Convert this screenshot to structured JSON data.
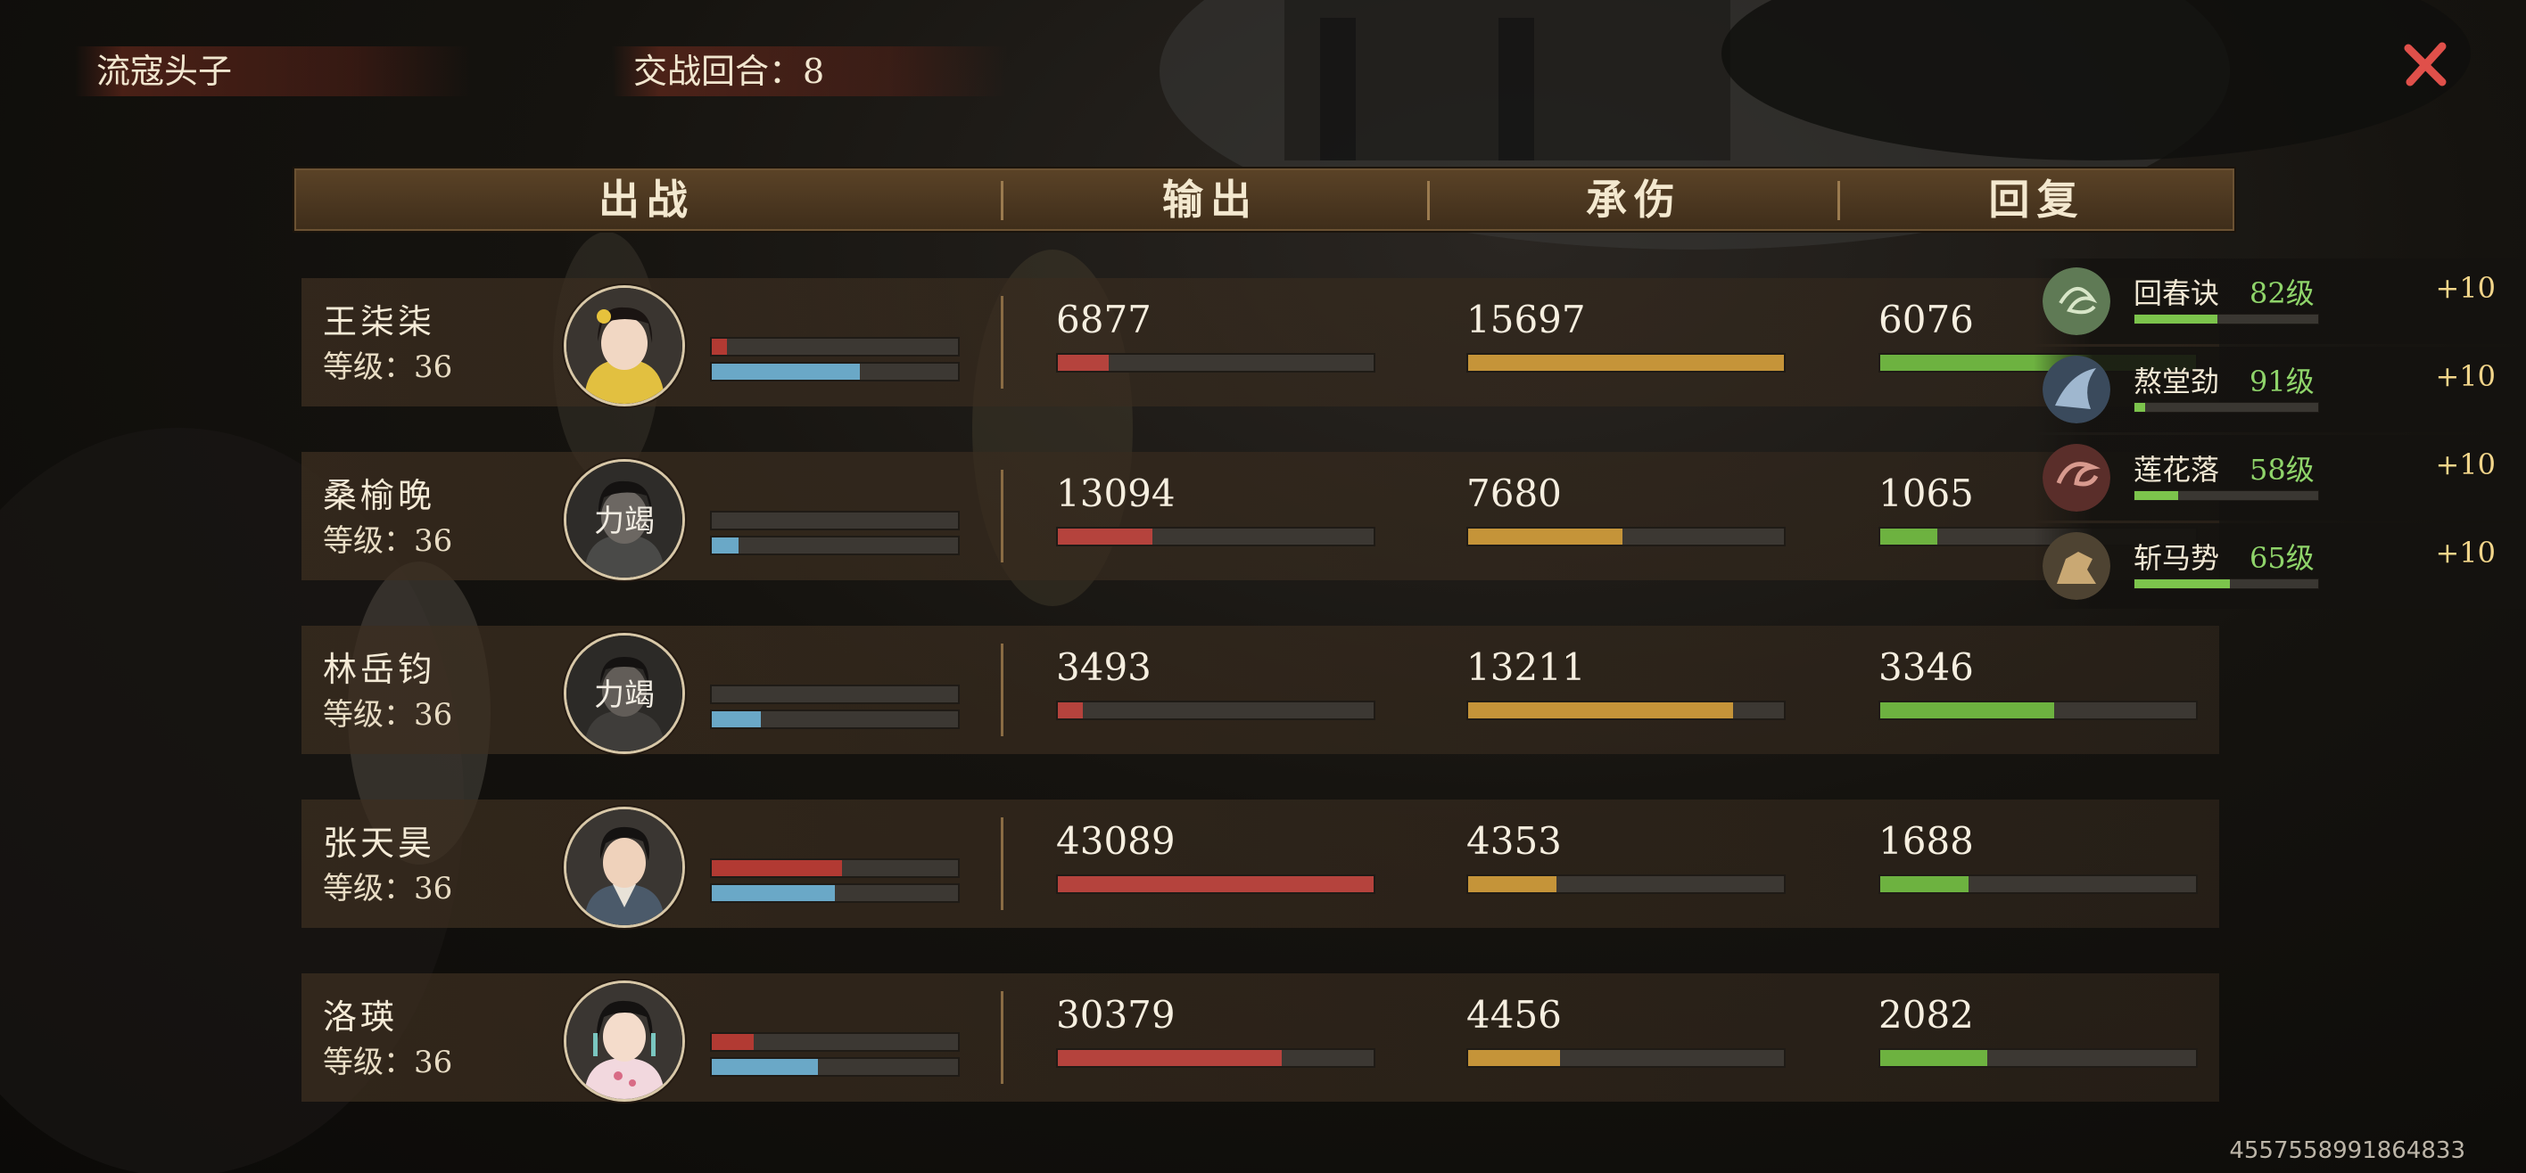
{
  "enemy_title": "流寇头子",
  "round_label": "交战回合：8",
  "headers": {
    "deploy": "出战",
    "output": "输出",
    "damage_taken": "承伤",
    "recovery": "回复"
  },
  "characters": [
    {
      "name": "王柒柒",
      "level": "等级：36",
      "hp_pct": 6,
      "energy_pct": 60,
      "output": "6877",
      "output_pct": 16,
      "taken": "15697",
      "taken_pct": 100,
      "recovery": "6076",
      "recovery_pct": 100,
      "portrait": "woman-yellow"
    },
    {
      "name": "桑榆晚",
      "level": "等级：36",
      "hp_pct": 0,
      "energy_pct": 11,
      "output": "13094",
      "output_pct": 30,
      "taken": "7680",
      "taken_pct": 49,
      "recovery": "1065",
      "recovery_pct": 18,
      "portrait": "exhausted",
      "status": "力竭"
    },
    {
      "name": "林岳钧",
      "level": "等级：36",
      "hp_pct": 0,
      "energy_pct": 20,
      "output": "3493",
      "output_pct": 8,
      "taken": "13211",
      "taken_pct": 84,
      "recovery": "3346",
      "recovery_pct": 55,
      "portrait": "exhausted",
      "status": "力竭"
    },
    {
      "name": "张天昊",
      "level": "等级：36",
      "hp_pct": 53,
      "energy_pct": 50,
      "output": "43089",
      "output_pct": 100,
      "taken": "4353",
      "taken_pct": 28,
      "recovery": "1688",
      "recovery_pct": 28,
      "portrait": "man-dark"
    },
    {
      "name": "洛瑛",
      "level": "等级：36",
      "hp_pct": 17,
      "energy_pct": 43,
      "output": "30379",
      "output_pct": 71,
      "taken": "4456",
      "taken_pct": 29,
      "recovery": "2082",
      "recovery_pct": 34,
      "portrait": "woman-white"
    }
  ],
  "skills": [
    {
      "name": "回春诀",
      "level": "82级",
      "bonus": "+10",
      "progress_pct": 45,
      "icon": "swirl-green-icon"
    },
    {
      "name": "熬堂劲",
      "level": "91级",
      "bonus": "+10",
      "progress_pct": 6,
      "icon": "blue-figure-icon"
    },
    {
      "name": "莲花落",
      "level": "58级",
      "bonus": "+10",
      "progress_pct": 24,
      "icon": "red-swirl-icon"
    },
    {
      "name": "斩马势",
      "level": "65级",
      "bonus": "+10",
      "progress_pct": 52,
      "icon": "horse-icon"
    }
  ],
  "footer_id": "4557558991864833",
  "colors": {
    "hp": "#b23a33",
    "energy": "#6aa8c7",
    "output": "#b5433d",
    "taken": "#c59439",
    "recovery": "#6db240",
    "skill": "#7cc44c",
    "close": "#e0504a"
  }
}
